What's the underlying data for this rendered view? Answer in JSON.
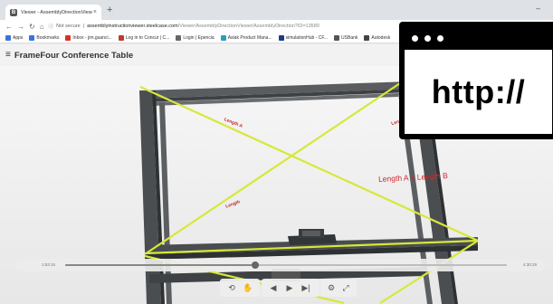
{
  "browser": {
    "tab_title": "Viewer - AssemblyDirectionView",
    "tab_close": "×",
    "new_tab": "+",
    "minimize": "–",
    "security_label": "Not secure",
    "url_host": "assemblyinstructionviewer.steelcase.com",
    "url_path": "/Viewer/AssemblyDirectionViewer/AssemblyDirection?ID=13580"
  },
  "bookmarks": [
    {
      "label": "Apps",
      "color": "#3b73d9"
    },
    {
      "label": "Bookmarks",
      "color": "#3b73d9"
    },
    {
      "label": "Inbox - jim.guanci...",
      "color": "#d93025"
    },
    {
      "label": "Log in to Concur | C...",
      "color": "#c0392b"
    },
    {
      "label": "Login | Epencia",
      "color": "#666666"
    },
    {
      "label": "Aslak Product Mana...",
      "color": "#2aa0b8"
    },
    {
      "label": "simulationHub - CF...",
      "color": "#1f3c88"
    },
    {
      "label": "USBank",
      "color": "#555555"
    },
    {
      "label": "Autodesk",
      "color": "#444444"
    }
  ],
  "page": {
    "menu_icon": "≡",
    "title": "FrameFour Conference Table"
  },
  "viewer": {
    "annotation": "Length A = Length B",
    "small_label_1": "Length A",
    "small_label_2": "Length B",
    "small_label_3": "Length"
  },
  "timeline": {
    "start_time": "1:53:15",
    "end_time": "4:30:29",
    "progress": 0.43
  },
  "controls": {
    "reset_glyph": "⟲",
    "pan_glyph": "✋",
    "prev_glyph": "◀",
    "play_glyph": "▶",
    "next_glyph": "▶|",
    "settings_glyph": "⚙",
    "fullscreen_glyph": "⤢"
  },
  "overlay": {
    "http_text": "http://"
  },
  "colors": {
    "guide_line": "#d7e83a",
    "annotation_red": "#d1262b",
    "frame": "#4c4f52",
    "background_blue": "#1c8fd3"
  }
}
